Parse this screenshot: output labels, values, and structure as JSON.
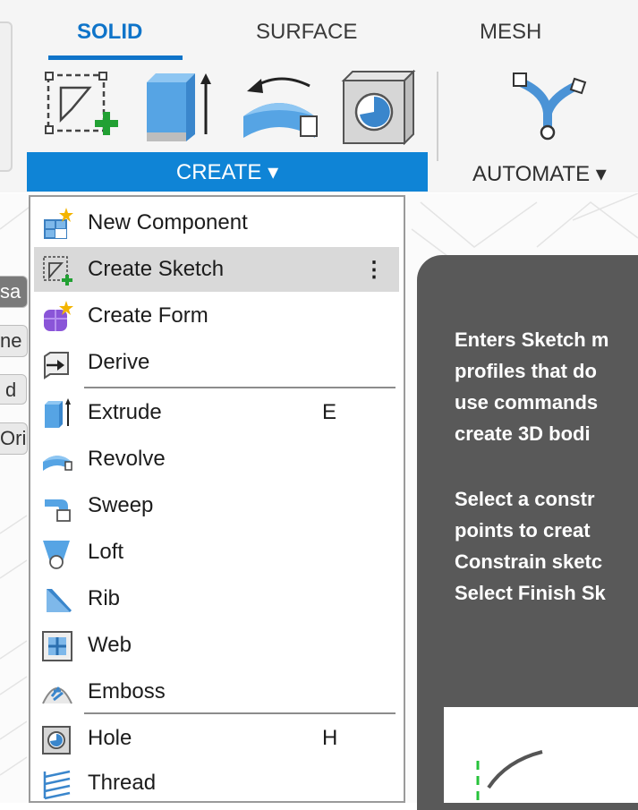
{
  "ribbon": {
    "tabs": [
      {
        "label": "SOLID",
        "active": true
      },
      {
        "label": "SURFACE",
        "active": false
      },
      {
        "label": "MESH",
        "active": false
      }
    ],
    "groups": {
      "create": "CREATE ▾",
      "automate": "AUTOMATE ▾"
    },
    "tools": [
      "create-sketch-icon",
      "extrude-icon",
      "revolve-icon",
      "hole-icon",
      "automate-icon"
    ]
  },
  "canvas": {
    "side_tags": [
      "sa",
      "ne",
      "d",
      "Ori"
    ]
  },
  "menu": {
    "items": [
      {
        "label": "New Component",
        "shortcut": "",
        "icon": "new-component-icon"
      },
      {
        "label": "Create Sketch",
        "shortcut": "⋮",
        "icon": "create-sketch-icon",
        "highlighted": true
      },
      {
        "label": "Create Form",
        "shortcut": "",
        "icon": "create-form-icon"
      },
      {
        "label": "Derive",
        "shortcut": "",
        "icon": "derive-icon"
      },
      {
        "label": "Extrude",
        "shortcut": "E",
        "icon": "extrude-icon"
      },
      {
        "label": "Revolve",
        "shortcut": "",
        "icon": "revolve-icon"
      },
      {
        "label": "Sweep",
        "shortcut": "",
        "icon": "sweep-icon"
      },
      {
        "label": "Loft",
        "shortcut": "",
        "icon": "loft-icon"
      },
      {
        "label": "Rib",
        "shortcut": "",
        "icon": "rib-icon"
      },
      {
        "label": "Web",
        "shortcut": "",
        "icon": "web-icon"
      },
      {
        "label": "Emboss",
        "shortcut": "",
        "icon": "emboss-icon"
      },
      {
        "label": "Hole",
        "shortcut": "H",
        "icon": "hole-icon"
      },
      {
        "label": "Thread",
        "shortcut": "",
        "icon": "thread-icon"
      }
    ]
  },
  "tooltip": {
    "lines": [
      "Enters Sketch m",
      "profiles that do",
      "use commands",
      "create 3D bodi",
      "",
      "Select a constr",
      "points to creat",
      "Constrain sketc",
      "Select Finish Sk"
    ]
  },
  "colors": {
    "accent": "#0f84d6",
    "tab_active": "#0f74c9",
    "tooltip_bg": "#595959",
    "highlight": "#d9d9d9"
  }
}
